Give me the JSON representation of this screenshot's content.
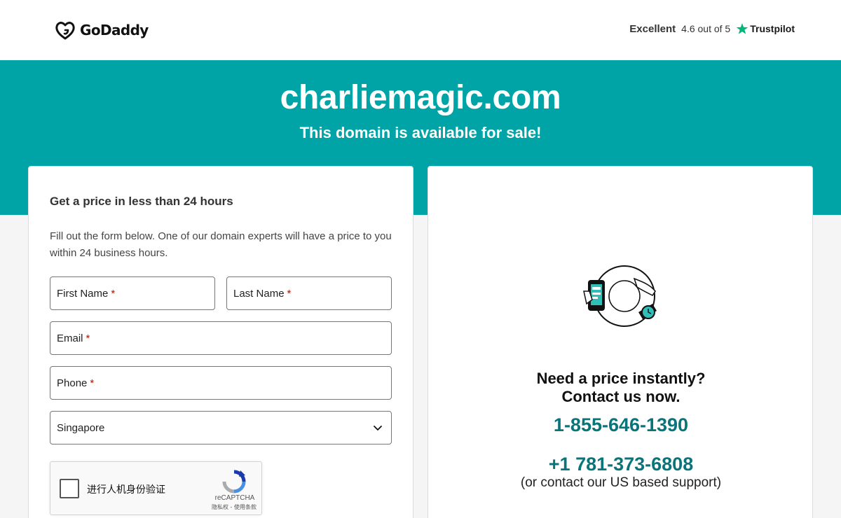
{
  "header": {
    "logo_text": "GoDaddy",
    "rating_word": "Excellent",
    "rating_score": "4.6 out of 5",
    "trustpilot": "Trustpilot"
  },
  "hero": {
    "domain": "charliemagic.com",
    "subtitle": "This domain is available for sale!"
  },
  "form": {
    "title": "Get a price in less than 24 hours",
    "description": "Fill out the form below. One of our domain experts will have a price to you within 24 business hours.",
    "first_name_label": "First Name",
    "last_name_label": "Last Name",
    "email_label": "Email",
    "phone_label": "Phone",
    "required_mark": "*",
    "country_value": "Singapore",
    "captcha": {
      "label": "进行人机身份验证",
      "brand": "reCAPTCHA",
      "terms": "隐私权 - 使用条款"
    }
  },
  "contact": {
    "heading_line1": "Need a price instantly?",
    "heading_line2": "Contact us now.",
    "phone_primary": "1-855-646-1390",
    "phone_secondary": "+1 781-373-6808",
    "support_note": "(or contact our US based support)"
  },
  "colors": {
    "brand_teal": "#00a4a6",
    "phone_teal": "#09757a",
    "trustpilot_green": "#00b67a",
    "required_red": "#ae1302"
  },
  "icons": [
    "godaddy-logo-icon",
    "trustpilot-star-icon",
    "chevron-down-icon",
    "recaptcha-icon",
    "phone-clock-illustration"
  ]
}
